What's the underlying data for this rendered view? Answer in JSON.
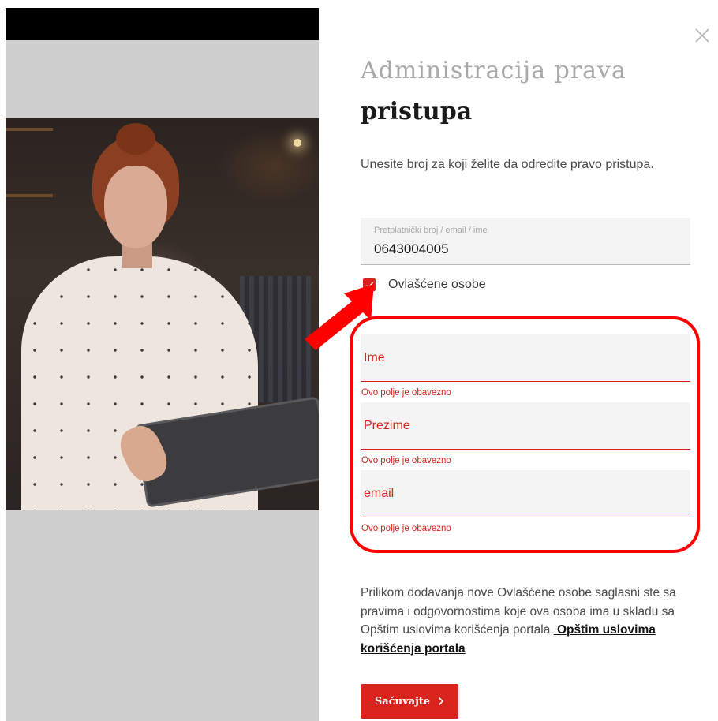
{
  "dialog": {
    "title_line1": "Administracija prava",
    "title_line2": "pristupa",
    "subtitle": "Unesite broj za koji želite da odredite pravo pristupa.",
    "close_icon": "close-icon"
  },
  "subscriber_field": {
    "label": "Pretplatnički broj / email / ime",
    "value": "0643004005"
  },
  "authorized_checkbox": {
    "label": "Ovlašćene osobe",
    "checked": true
  },
  "person_fields": [
    {
      "placeholder": "Ime",
      "error": "Ovo polje je obavezno"
    },
    {
      "placeholder": "Prezime",
      "error": "Ovo polje je obavezno"
    },
    {
      "placeholder": "email",
      "error": "Ovo polje je obavezno"
    }
  ],
  "notice": {
    "text": "Prilikom dodavanja nove Ovlašćene osobe saglasni ste sa pravima i odgovornostima koje ova osoba ima u skladu sa Opštim uslovima korišćenja portala.",
    "link_text": " Opštim uslovima korišćenja portala"
  },
  "save_button": {
    "label": "Sačuvajte",
    "icon": "chevron-right-icon"
  },
  "colors": {
    "accent": "#d9231d",
    "annotation": "#ff0000",
    "field_bg": "#f4f4f4"
  }
}
